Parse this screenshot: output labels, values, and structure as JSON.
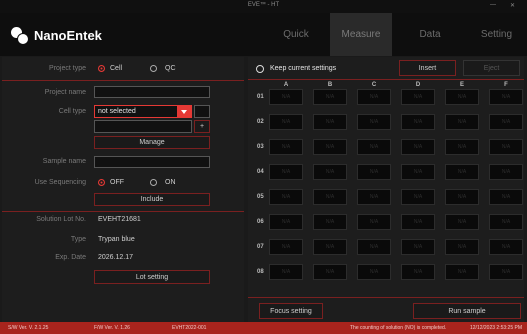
{
  "window": {
    "title": "EVE™ - HT",
    "minimize": "—",
    "close": "✕"
  },
  "brand": {
    "name": "NanoEntek"
  },
  "nav": [
    {
      "label": "Quick"
    },
    {
      "label": "Measure"
    },
    {
      "label": "Data"
    },
    {
      "label": "Setting"
    }
  ],
  "left": {
    "project_type_label": "Project type",
    "project_type_options": [
      "Cell",
      "QC"
    ],
    "project_name_label": "Project name",
    "project_name_value": "",
    "cell_type_label": "Cell type",
    "cell_type_value": "not selected",
    "plus": "+",
    "manage_label": "Manage",
    "sample_name_label": "Sample name",
    "sample_name_value": "",
    "use_sequencing_label": "Use Sequencing",
    "sequencing_options": [
      "OFF",
      "ON"
    ],
    "include_label": "Include",
    "solution_lot_label": "Solution Lot No.",
    "solution_lot_value": "EVEHT21681",
    "type_label": "Type",
    "type_value": "Trypan blue",
    "exp_date_label": "Exp. Date",
    "exp_date_value": "2026.12.17",
    "lot_setting_label": "Lot setting"
  },
  "right": {
    "keep_settings_label": "Keep current settings",
    "insert_label": "Insert",
    "eject_label": "Eject",
    "columns": [
      "A",
      "B",
      "C",
      "D",
      "E",
      "F"
    ],
    "rows": [
      "01",
      "02",
      "03",
      "04",
      "05",
      "06",
      "07",
      "08"
    ],
    "well_text": "N/A",
    "focus_setting_label": "Focus setting",
    "run_sample_label": "Run sample"
  },
  "status": {
    "sw_ver": "S/W Ver. V. 2.1.25",
    "fw_ver": "F/W Ver. V. 1.26",
    "device": "EVHT2022-001",
    "message": "The counting of solution (NO) is completed.",
    "datetime": "12/12/2023 2:53:25 PM"
  },
  "colors": {
    "accent": "#e53935",
    "status_bar": "#a8241d",
    "border": "#7a2020"
  }
}
